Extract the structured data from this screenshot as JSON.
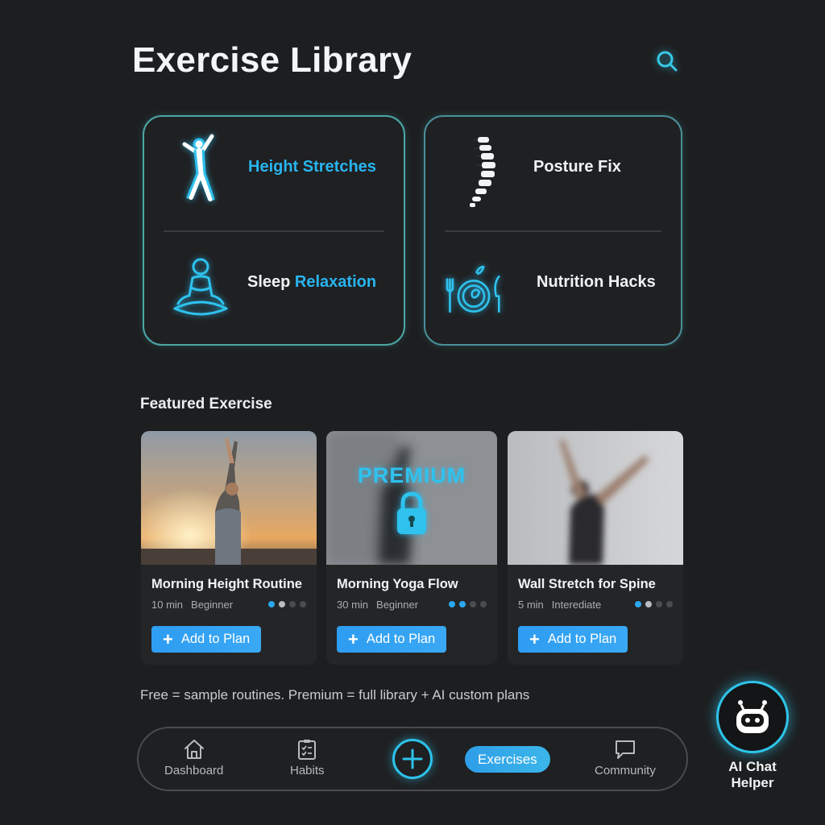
{
  "header": {
    "title": "Exercise Library",
    "search_icon": "search-icon"
  },
  "categories": [
    {
      "icon": "stretching-person-icon",
      "label_plain": "",
      "label_accent": "Height Stretches"
    },
    {
      "icon": "meditation-person-icon",
      "label_plain": "Sleep ",
      "label_accent": "Relaxation"
    },
    {
      "icon": "spine-icon",
      "label_plain": "Posture Fix",
      "label_accent": ""
    },
    {
      "icon": "plate-cutlery-icon",
      "label_plain": "Nutrition Hacks",
      "label_accent": ""
    }
  ],
  "featured": {
    "section_title": "Featured Exercise",
    "premium_badge": "PREMIUM",
    "exercises": [
      {
        "name": "Morning Height Routine",
        "duration": "10 min",
        "level": "Beginner",
        "difficulty": 2,
        "button": "Add to Plan",
        "locked": false
      },
      {
        "name": "Morning Yoga Flow",
        "duration": "30 min",
        "level": "Beginner",
        "difficulty": 2,
        "button": "Add to Plan",
        "locked": true
      },
      {
        "name": "Wall Stretch for Spine",
        "duration": "5 min",
        "level": "Interediate",
        "difficulty": 2,
        "button": "Add to Plan",
        "locked": false
      }
    ]
  },
  "footnote": "Free = sample routines. Premium = full library + AI custom plans",
  "nav": {
    "items": [
      {
        "label": "Dashboard",
        "icon": "home-icon"
      },
      {
        "label": "Habits",
        "icon": "checklist-icon"
      },
      {
        "label": "Exercises",
        "icon": "",
        "active": true
      },
      {
        "label": "Community",
        "icon": "chat-bubble-icon"
      }
    ],
    "add_icon": "plus-icon"
  },
  "ai_helper": {
    "label": "AI Chat Helper",
    "icon": "robot-icon"
  },
  "colors": {
    "background": "#1d1e20",
    "accent": "#28b5f0",
    "panel_border": "#4aa7a6",
    "button": "#2e9df2"
  }
}
